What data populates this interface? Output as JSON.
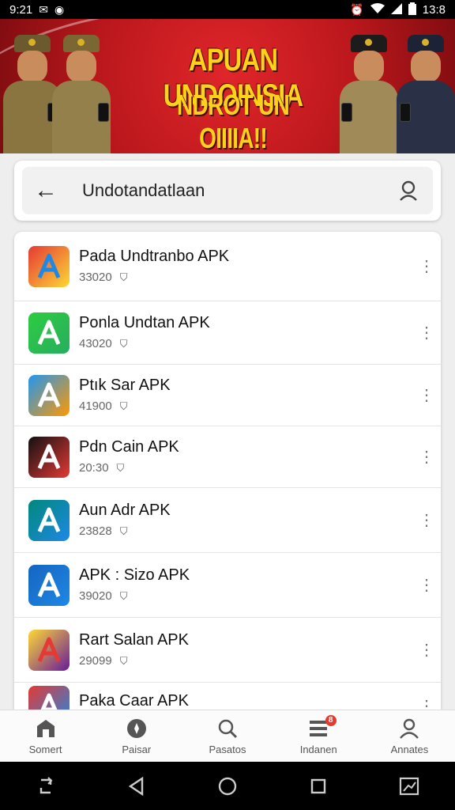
{
  "status_bar": {
    "time": "9:21",
    "left_icons": [
      "message-icon",
      "alarm-icon",
      "sync-icon"
    ],
    "right_icons": [
      "alarm-icon",
      "wifi-icon",
      "signal-icon",
      "battery-icon"
    ],
    "clock": "13:8"
  },
  "banner": {
    "title": "APUAN UNDOINSIA",
    "subtitle": "NDROT UN OIIIIA!!"
  },
  "search": {
    "value": "Undotandatlaan"
  },
  "apps": [
    {
      "name": "Pada Undtranbo APK",
      "meta": "33020",
      "colors": [
        "#e53935",
        "#fdd835",
        "#1e88e5"
      ]
    },
    {
      "name": "Ponla Undtan APK",
      "meta": "43020",
      "colors": [
        "#2ecc40",
        "#27ae60",
        "#ffffff"
      ]
    },
    {
      "name": "Ptık Sar APK",
      "meta": "41900",
      "colors": [
        "#2196f3",
        "#ff9800",
        "#ffffff"
      ]
    },
    {
      "name": "Pdn Cain APK",
      "meta": "20:30",
      "colors": [
        "#111111",
        "#e53935",
        "#ffffff"
      ]
    },
    {
      "name": "Aun Adr APK",
      "meta": "23828",
      "colors": [
        "#00897b",
        "#1e88e5",
        "#ffffff"
      ]
    },
    {
      "name": "APK : Sizo APK",
      "meta": "39020",
      "colors": [
        "#1565c0",
        "#1e88e5",
        "#ffffff"
      ]
    },
    {
      "name": "Rart Salan APK",
      "meta": "29099",
      "colors": [
        "#fdd835",
        "#6a1b9a",
        "#e53935"
      ]
    },
    {
      "name": "Paka Caar APK",
      "meta": "",
      "colors": [
        "#e53935",
        "#1e88e5",
        "#ffffff"
      ]
    }
  ],
  "bottom_nav": [
    {
      "label": "Somert",
      "icon": "store-icon"
    },
    {
      "label": "Paisar",
      "icon": "compass-icon"
    },
    {
      "label": "Pasatos",
      "icon": "search-icon"
    },
    {
      "label": "Indanen",
      "icon": "list-icon",
      "badge": "8"
    },
    {
      "label": "Annates",
      "icon": "person-icon"
    }
  ],
  "system_nav": [
    "rotate-icon",
    "back-icon",
    "home-icon",
    "recents-icon",
    "screenshot-icon"
  ]
}
